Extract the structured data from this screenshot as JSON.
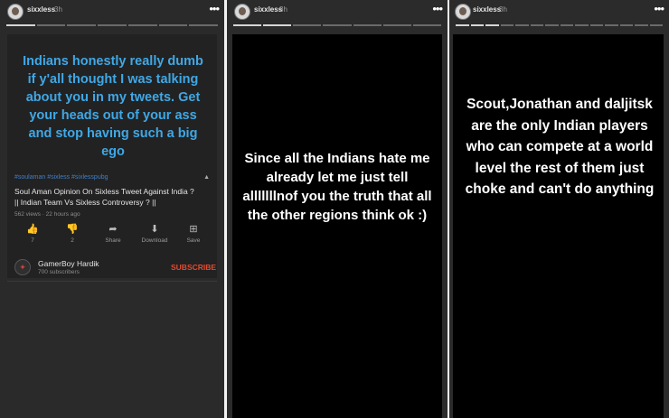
{
  "panels": [
    {
      "username": "sixxless",
      "time": "3h",
      "story_text": "Indians honestly really dumb if y'all thought I was talking about you in my tweets. Get your heads out of your ass and stop having such a big ego",
      "text_color": "#3fa8e6",
      "progress": [
        1,
        0,
        0,
        0,
        0,
        0,
        0
      ],
      "video": {
        "tags": "#soulaman #sixless #sixlesspubg",
        "title": "Soul Aman Opinion On Sixless Tweet Against India ? || Indian Team Vs Sixless Controversy ? ||",
        "meta": "562 views · 22 hours ago",
        "actions": [
          {
            "icon": "thumbs-up-icon",
            "glyph": "👍",
            "label": "7"
          },
          {
            "icon": "thumbs-down-icon",
            "glyph": "👎",
            "label": "2"
          },
          {
            "icon": "share-icon",
            "glyph": "➦",
            "label": "Share"
          },
          {
            "icon": "download-icon",
            "glyph": "⬇",
            "label": "Download"
          },
          {
            "icon": "save-icon",
            "glyph": "⊞",
            "label": "Save"
          }
        ],
        "channel": "GamerBoy Hardik",
        "subscribers": "700 subscribers",
        "subscribe_label": "SUBSCRIBE",
        "subscribe_color": "#e34a2f"
      }
    },
    {
      "username": "sixxless",
      "time": "3h",
      "story_text": "Since all the Indians hate me already let me just tell alllllllnof you the truth that all the other regions think ok :)",
      "progress": [
        1,
        1,
        0,
        0,
        0,
        0,
        0
      ]
    },
    {
      "username": "sixxless",
      "time": "3h",
      "story_text": "Scout,Jonathan and daljitsk are the only Indian players who can compete at a world level the rest of them just choke and can't do anything",
      "progress": [
        1,
        1,
        1,
        0,
        0,
        0,
        0,
        0,
        0,
        0,
        0,
        0,
        0,
        0
      ]
    }
  ]
}
